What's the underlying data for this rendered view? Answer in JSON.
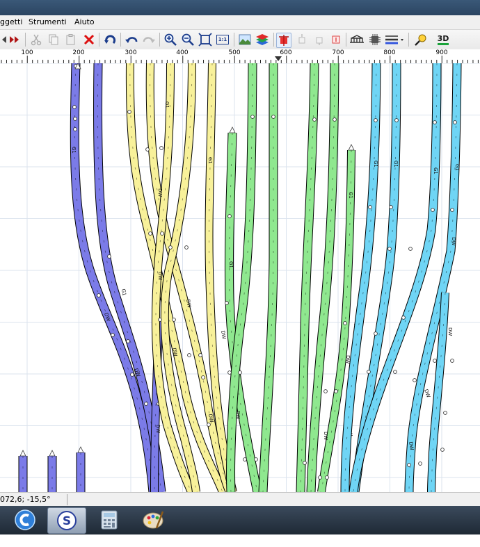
{
  "menubar": {
    "items": [
      "ggetti",
      "Strumenti",
      "Aiuto"
    ]
  },
  "toolbar": {
    "icons": [
      "move-back-icon",
      "move-forward-icon",
      "cut-icon",
      "copy-icon",
      "paste-icon",
      "delete-icon",
      "rotate-icon",
      "undo-icon",
      "redo-icon",
      "zoom-in-icon",
      "zoom-out-icon",
      "zoom-fit-icon",
      "zoom-1to1-icon",
      "background-image-icon",
      "layers-icon",
      "track-tool-icon",
      "tool-a-icon",
      "tool-b-icon",
      "tool-c-icon",
      "bridge-icon",
      "chip-icon",
      "line-style-icon",
      "measure-icon",
      "3d-view-icon"
    ],
    "zoom_1to1_label": "1:1",
    "view_3d_label": "3D"
  },
  "ruler": {
    "labels": [
      "100",
      "200",
      "300",
      "400",
      "500",
      "600",
      "700",
      "800",
      "900"
    ]
  },
  "status": {
    "coords": "072,6; -15,5°"
  },
  "colors": {
    "blue_track": "#7b7be8",
    "yellow_track": "#f8f19a",
    "green_track": "#8fe88f",
    "cyan_track": "#6fd5f5",
    "grid": "#dbe3ee"
  },
  "tracks": {
    "label_a": "G1",
    "label_b": "DW"
  }
}
